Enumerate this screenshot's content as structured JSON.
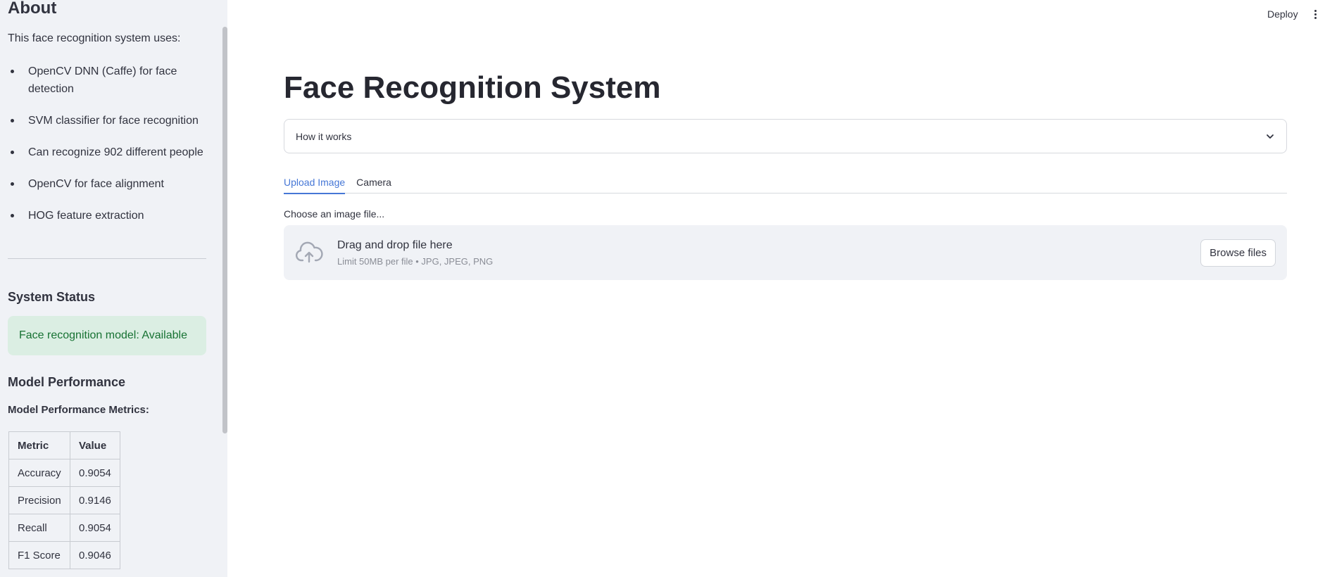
{
  "sidebar": {
    "about_title": "About",
    "intro": "This face recognition system uses:",
    "features": [
      "OpenCV DNN (Caffe) for face detection",
      "SVM classifier for face recognition",
      "Can recognize 902 different people",
      "OpenCV for face alignment",
      "HOG feature extraction"
    ],
    "status_title": "System Status",
    "status_message": "Face recognition model: Available",
    "performance_title": "Model Performance",
    "performance_subtitle": "Model Performance Metrics:",
    "metrics_headers": [
      "Metric",
      "Value"
    ],
    "metrics_rows": [
      [
        "Accuracy",
        "0.9054"
      ],
      [
        "Precision",
        "0.9146"
      ],
      [
        "Recall",
        "0.9054"
      ],
      [
        "F1 Score",
        "0.9046"
      ]
    ]
  },
  "header": {
    "deploy_label": "Deploy",
    "menu_icon": "kebab-menu-icon"
  },
  "main": {
    "title": "Face Recognition System",
    "expander_label": "How it works",
    "tabs": [
      {
        "label": "Upload Image",
        "active": true
      },
      {
        "label": "Camera",
        "active": false
      }
    ],
    "uploader": {
      "label": "Choose an image file...",
      "drop_text": "Drag and drop file here",
      "limit_text": "Limit 50MB per file • JPG, JPEG, PNG",
      "browse_label": "Browse files",
      "icon": "cloud-upload-icon"
    }
  },
  "colors": {
    "accent": "#4677d6",
    "success_bg": "#dbeee3",
    "success_text": "#177233",
    "sidebar_bg": "#f0f2f6"
  }
}
